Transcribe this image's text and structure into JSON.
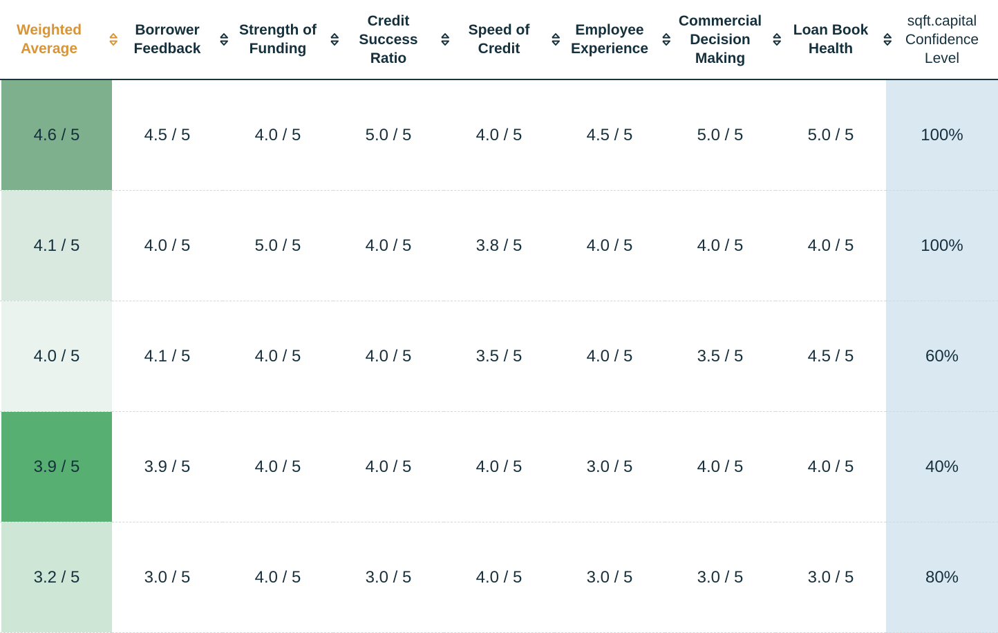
{
  "table": {
    "columns": [
      {
        "label": "Weighted\nAverage",
        "sortable": true,
        "active": true
      },
      {
        "label": "Borrower\nFeedback",
        "sortable": true,
        "active": false
      },
      {
        "label": "Strength of\nFunding",
        "sortable": true,
        "active": false
      },
      {
        "label": "Credit\nSuccess\nRatio",
        "sortable": true,
        "active": false
      },
      {
        "label": "Speed of\nCredit",
        "sortable": true,
        "active": false
      },
      {
        "label": "Employee\nExperience",
        "sortable": true,
        "active": false
      },
      {
        "label": "Commercial\nDecision\nMaking",
        "sortable": true,
        "active": false
      },
      {
        "label": "Loan Book\nHealth",
        "sortable": true,
        "active": false
      },
      {
        "label": "sqft.capital\nConfidence\nLevel",
        "sortable": false,
        "active": false
      }
    ],
    "rows": [
      {
        "weighted_average": "4.6 / 5",
        "weighted_color": "#7fb08e",
        "borrower_feedback": "4.5 / 5",
        "strength_of_funding": "4.0 / 5",
        "credit_success_ratio": "5.0 / 5",
        "speed_of_credit": "4.0 / 5",
        "employee_experience": "4.5 / 5",
        "commercial_decision_making": "5.0 / 5",
        "loan_book_health": "5.0 / 5",
        "confidence_level": "100%"
      },
      {
        "weighted_average": "4.1 / 5",
        "weighted_color": "#d9e9df",
        "borrower_feedback": "4.0 / 5",
        "strength_of_funding": "5.0 / 5",
        "credit_success_ratio": "4.0 / 5",
        "speed_of_credit": "3.8 / 5",
        "employee_experience": "4.0 / 5",
        "commercial_decision_making": "4.0 / 5",
        "loan_book_health": "4.0 / 5",
        "confidence_level": "100%"
      },
      {
        "weighted_average": "4.0 / 5",
        "weighted_color": "#eaf3ee",
        "borrower_feedback": "4.1 / 5",
        "strength_of_funding": "4.0 / 5",
        "credit_success_ratio": "4.0 / 5",
        "speed_of_credit": "3.5 / 5",
        "employee_experience": "4.0 / 5",
        "commercial_decision_making": "3.5 / 5",
        "loan_book_health": "4.5 / 5",
        "confidence_level": "60%"
      },
      {
        "weighted_average": "3.9 / 5",
        "weighted_color": "#57b072",
        "borrower_feedback": "3.9 / 5",
        "strength_of_funding": "4.0 / 5",
        "credit_success_ratio": "4.0 / 5",
        "speed_of_credit": "4.0 / 5",
        "employee_experience": "3.0 / 5",
        "commercial_decision_making": "4.0 / 5",
        "loan_book_health": "4.0 / 5",
        "confidence_level": "40%"
      },
      {
        "weighted_average": "3.2 / 5",
        "weighted_color": "#cde6d6",
        "borrower_feedback": "3.0 / 5",
        "strength_of_funding": "4.0 / 5",
        "credit_success_ratio": "3.0 / 5",
        "speed_of_credit": "4.0 / 5",
        "employee_experience": "3.0 / 5",
        "commercial_decision_making": "3.0 / 5",
        "loan_book_health": "3.0 / 5",
        "confidence_level": "80%"
      }
    ]
  },
  "colors": {
    "active_header": "#d99436",
    "text": "#15303d",
    "confidence_bg": "#d9e8f1"
  },
  "icons": {
    "sort": "sort-up-down-icon"
  }
}
